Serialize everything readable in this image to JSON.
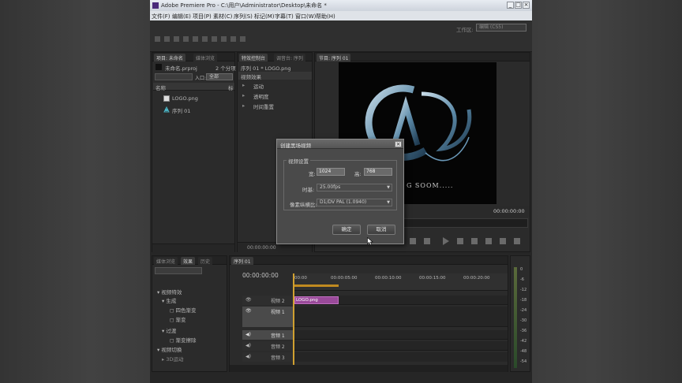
{
  "window": {
    "title": "Adobe Premiere Pro - C:\\用户\\Administrator\\Desktop\\未命名 *",
    "controls": [
      "_",
      "□",
      "×"
    ]
  },
  "menu": [
    "文件(F)",
    "编辑(E)",
    "项目(P)",
    "素材(C)",
    "序列(S)",
    "标记(M)",
    "字幕(T)",
    "窗口(W)",
    "帮助(H)"
  ],
  "workspace": {
    "label": "工作区:",
    "value": "编辑 (CS5)"
  },
  "project_panel": {
    "tabs": [
      "项目: 未命名",
      "媒体浏览"
    ],
    "file": "未命名.prproj",
    "count": "2 个分项",
    "in_label": "入口:",
    "in_value": "全部",
    "col_name": "名称",
    "col_tag": "标",
    "items": [
      "LOGO.png",
      "序列 01"
    ]
  },
  "effect_controls": {
    "tabs": [
      "特效控制台",
      "调音台: 序列"
    ],
    "header": "序列 01 * LOGO.png",
    "section": "视频效果",
    "items": [
      "运动",
      "透明度",
      "时间重置"
    ],
    "timecode": "00:00:00:00"
  },
  "program": {
    "tab": "节目: 序列 01",
    "caption": "G  SOOM.....",
    "timecode": "00:00:00:00"
  },
  "dialog": {
    "title": "创建黑场视频",
    "group": "视频设置",
    "width_label": "宽:",
    "width_value": "1024",
    "height_label": "高:",
    "height_value": "768",
    "timebase_label": "时基:",
    "timebase_value": "25.00fps",
    "par_label": "像素纵横比:",
    "par_value": "D1/DV PAL (1.0940)",
    "ok": "确定",
    "cancel": "取消",
    "close": "×"
  },
  "effects_panel": {
    "tabs": [
      "媒体浏览",
      "效果",
      "历史"
    ],
    "items": [
      "视频特效",
      "生成",
      "四色渐变",
      "渐变",
      "过渡",
      "渐变擦除",
      "视频切换",
      "3D运动"
    ]
  },
  "timeline": {
    "tab": "序列 01",
    "timecode": "00:00:00:00",
    "ruler": [
      "00:00",
      "00:00:05:00",
      "00:00:10:00",
      "00:00:15:00",
      "00:00:20:00"
    ],
    "tracks": [
      "视频 2",
      "视频 1",
      "音频 1",
      "音频 2",
      "音频 3"
    ],
    "clip": "LOGO.png"
  },
  "meter": [
    "0",
    "-6",
    "-12",
    "-18",
    "-24",
    "-30",
    "-36",
    "-42",
    "-48",
    "-54"
  ],
  "colors": {
    "clip": "#9a4a9a",
    "accent": "#e0a020",
    "dialog_bg": "#4a4a4a"
  }
}
